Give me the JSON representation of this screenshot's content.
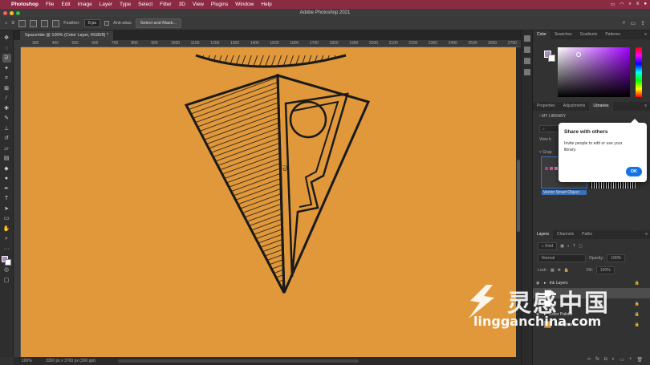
{
  "menubar": {
    "app": "Photoshop",
    "items": [
      "File",
      "Edit",
      "Image",
      "Layer",
      "Type",
      "Select",
      "Filter",
      "3D",
      "View",
      "Plugins",
      "Window",
      "Help"
    ]
  },
  "titlebar": {
    "title": "Adobe Photoshop 2021"
  },
  "options": {
    "feather_label": "Feather:",
    "feather_value": "0 px",
    "antialias_label": "Anti-alias",
    "select_mask": "Select and Mask..."
  },
  "document": {
    "tab": "Spaceride @ 100% (Color Layer, RGB/8) *",
    "ruler_ticks": [
      "300",
      "400",
      "500",
      "600",
      "700",
      "800",
      "900",
      "1000",
      "1100",
      "1200",
      "1300",
      "1400",
      "1500",
      "1600",
      "1700",
      "1800",
      "1900",
      "2000",
      "2100",
      "2200",
      "2300",
      "2400",
      "2500",
      "2600",
      "2700"
    ],
    "zoom": "100%",
    "dimensions": "3300 px x 3700 px (300 ppi)"
  },
  "color_panel": {
    "tabs": [
      "Color",
      "Swatches",
      "Gradients",
      "Patterns"
    ],
    "foreground": "#a98bc4",
    "background": "#ffffff"
  },
  "libraries_panel": {
    "tabs": [
      "Properties",
      "Adjustments",
      "Libraries"
    ],
    "header": "MY LIBRARY",
    "view_label": "View b",
    "graphics_label": "Grap",
    "item_label": "Vector Smart Object",
    "swatch_colors": [
      "#8b4aa8",
      "#c25aa0",
      "#d37ab5",
      "#e09bb8",
      "#d9a066",
      "#c8a058",
      "#e0b070"
    ]
  },
  "popover": {
    "title": "Share with others",
    "body": "Invite people to edit or use your library.",
    "ok": "OK"
  },
  "layers_panel": {
    "tabs": [
      "Layers",
      "Channels",
      "Paths"
    ],
    "kind": "Kind",
    "blend": "Normal",
    "opacity_label": "Opacity:",
    "opacity_value": "100%",
    "lock_label": "Lock:",
    "fill_label": "Fill:",
    "fill_value": "100%",
    "layers": [
      {
        "name": "Ink Layers"
      },
      {
        "name": ""
      },
      {
        "name": ""
      },
      {
        "name": "Color Palette"
      },
      {
        "name": "Background"
      }
    ]
  },
  "watermark": {
    "cn": "灵感中国",
    "url": "lingganchina.com"
  }
}
